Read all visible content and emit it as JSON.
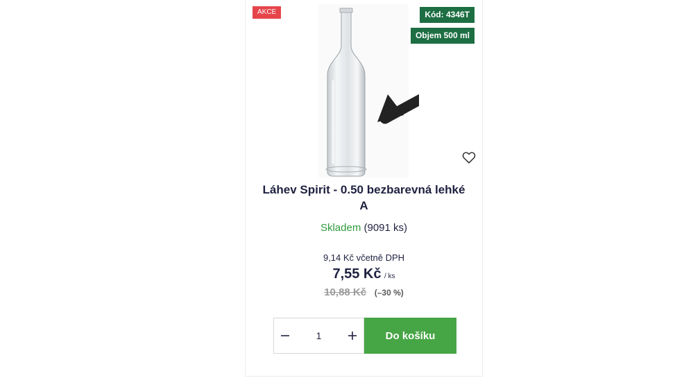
{
  "product": {
    "sale_badge": "AKCE",
    "code_badge": "Kód: 4346T",
    "volume_badge": "Objem 500 ml",
    "title": "Láhev Spirit - 0.50 bezbarevná lehké A",
    "stock_status": "Skladem",
    "stock_qty": "(9091 ks)",
    "price_with_vat": "9,14 Kč včetně DPH",
    "price": "7,55 Kč",
    "price_unit": "/ ks",
    "old_price": "10,88 Kč",
    "discount": "(–30 %)"
  },
  "cart": {
    "quantity": "1",
    "add_to_cart_label": "Do košíku"
  },
  "icons": {
    "wishlist": "heart-outline-icon",
    "minus": "minus-icon",
    "plus": "plus-icon"
  },
  "colors": {
    "sale_badge": "#e5454b",
    "info_badge": "#1d6e43",
    "in_stock": "#2e9a3d",
    "cart_button": "#46a544",
    "title": "#1f2140"
  }
}
